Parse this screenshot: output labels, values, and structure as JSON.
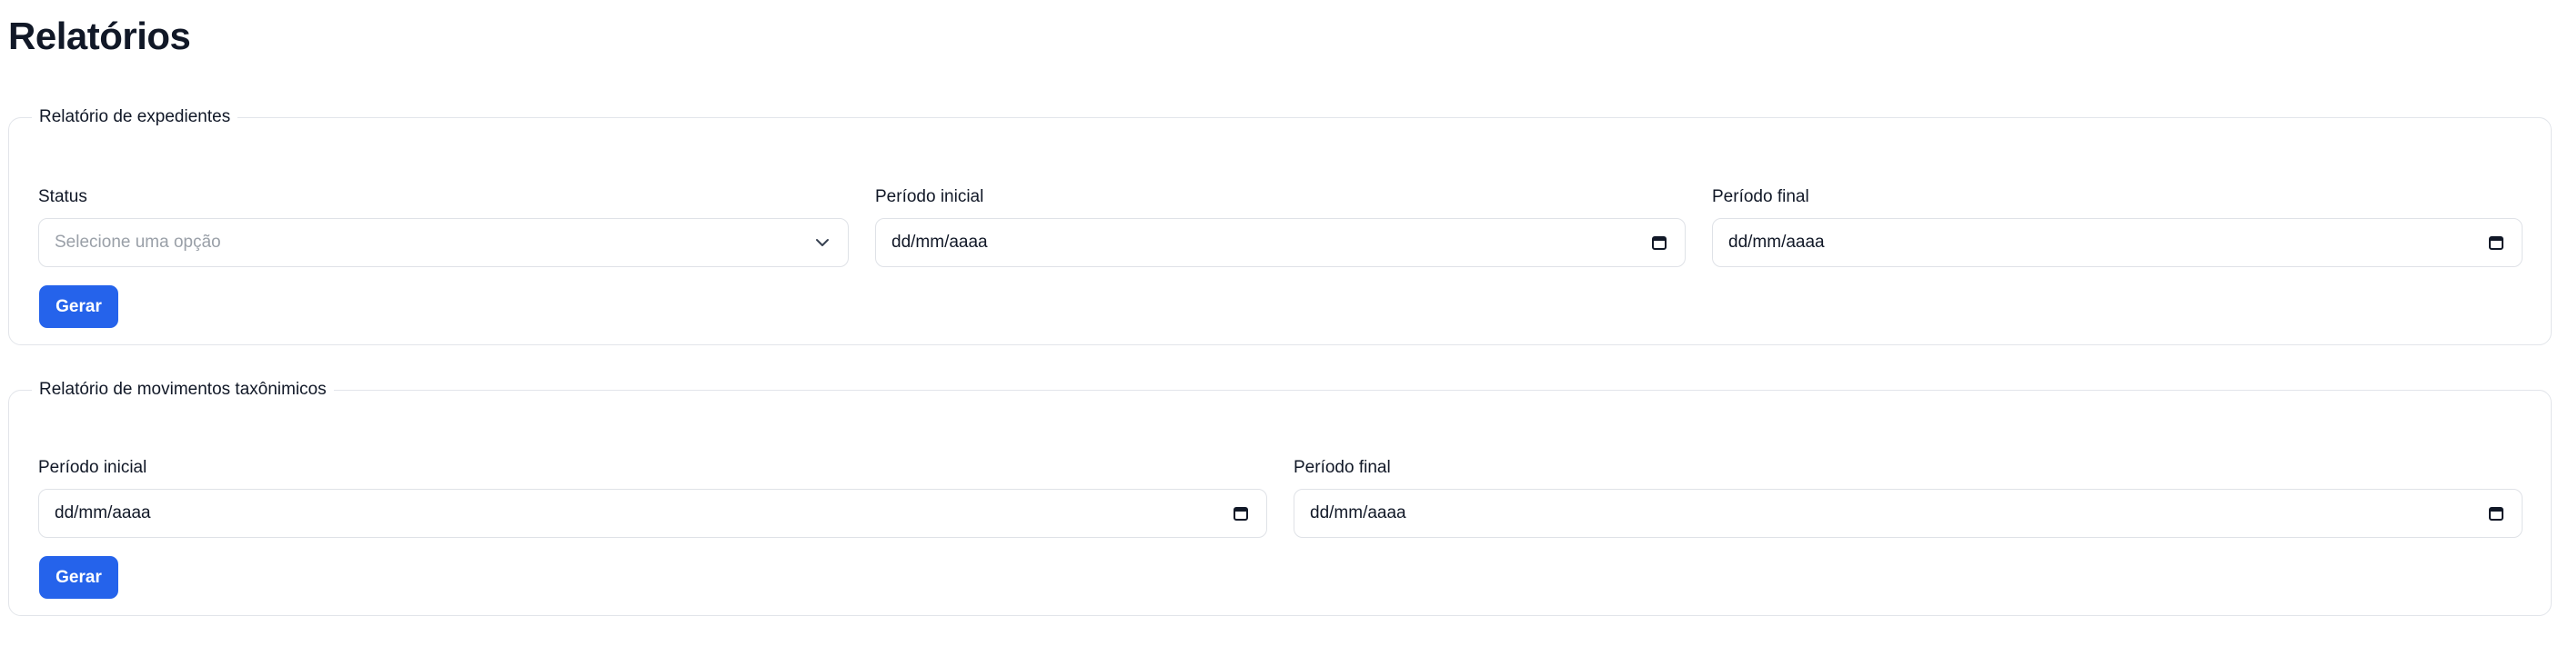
{
  "page": {
    "title": "Relatórios"
  },
  "expedientes": {
    "legend": "Relatório de expedientes",
    "status": {
      "label": "Status",
      "placeholder": "Selecione uma opção"
    },
    "inicial": {
      "label": "Período inicial",
      "value": "dd/mm/aaaa"
    },
    "final": {
      "label": "Período final",
      "value": "dd/mm/aaaa"
    },
    "button": "Gerar"
  },
  "movimentos": {
    "legend": "Relatório de movimentos taxônimicos",
    "inicial": {
      "label": "Período inicial",
      "value": "dd/mm/aaaa"
    },
    "final": {
      "label": "Período final",
      "value": "dd/mm/aaaa"
    },
    "button": "Gerar"
  },
  "icons": {
    "select": "chevron-down-icon",
    "date": "calendar-icon"
  },
  "colors": {
    "primary": "#2563eb",
    "border": "#e2e5ea",
    "placeholder": "#9aa0a8"
  }
}
